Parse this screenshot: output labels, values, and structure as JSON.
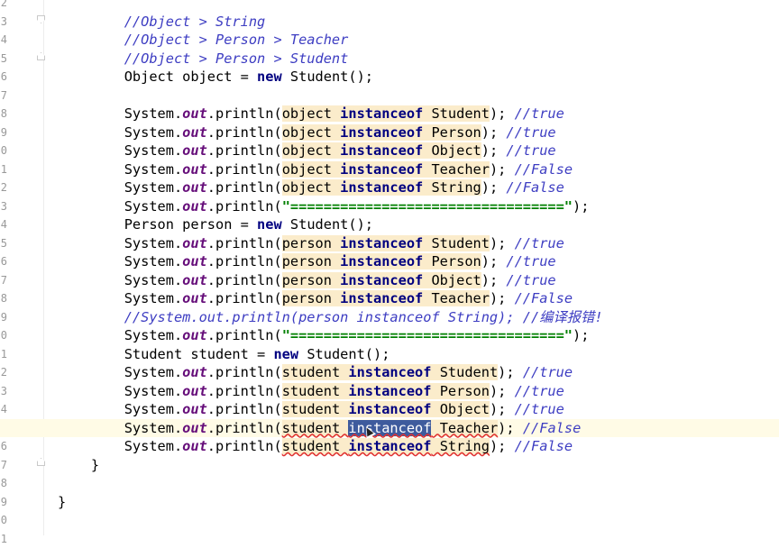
{
  "editor": {
    "line_numbers": [
      "2",
      "3",
      "4",
      "5",
      "6",
      "7",
      "8",
      "9",
      "0",
      "1",
      "2",
      "3",
      "4",
      "5",
      "6",
      "7",
      "8",
      "9",
      "0",
      "1",
      "2",
      "3",
      "4",
      "5",
      "6",
      "7",
      "8",
      "9",
      "0",
      "1"
    ],
    "colors": {
      "comment": "#3d3dc2",
      "keyword": "#000080",
      "static_field": "#660e7a",
      "string": "#008000",
      "match_highlight": "#fbeccb",
      "selection": "#3e5b9d",
      "current_line": "#fffbe6",
      "error_underline": "#e03030"
    },
    "lines": [
      {
        "indent": "",
        "segments": []
      },
      {
        "indent": "        ",
        "segments": [
          {
            "t": "cm",
            "s": "//Object > String"
          }
        ]
      },
      {
        "indent": "        ",
        "segments": [
          {
            "t": "cm",
            "s": "//Object > Person > Teacher"
          }
        ]
      },
      {
        "indent": "        ",
        "segments": [
          {
            "t": "cm",
            "s": "//Object > Person > Student"
          }
        ]
      },
      {
        "indent": "        ",
        "segments": [
          {
            "t": "",
            "s": "Object object = "
          },
          {
            "t": "kw",
            "s": "new"
          },
          {
            "t": "",
            "s": " Student();"
          }
        ]
      },
      {
        "indent": "",
        "segments": []
      },
      {
        "indent": "        ",
        "segments": [
          {
            "t": "",
            "s": "System."
          },
          {
            "t": "fld",
            "s": "out"
          },
          {
            "t": "",
            "s": ".println("
          },
          {
            "t": "hl",
            "s": "object "
          },
          {
            "t": "kw hl",
            "s": "instanceof"
          },
          {
            "t": "hl",
            "s": " Student"
          },
          {
            "t": "",
            "s": "); "
          },
          {
            "t": "cm",
            "s": "//true"
          }
        ]
      },
      {
        "indent": "        ",
        "segments": [
          {
            "t": "",
            "s": "System."
          },
          {
            "t": "fld",
            "s": "out"
          },
          {
            "t": "",
            "s": ".println("
          },
          {
            "t": "hl",
            "s": "object "
          },
          {
            "t": "kw hl",
            "s": "instanceof"
          },
          {
            "t": "hl",
            "s": " Person"
          },
          {
            "t": "",
            "s": "); "
          },
          {
            "t": "cm",
            "s": "//true"
          }
        ]
      },
      {
        "indent": "        ",
        "segments": [
          {
            "t": "",
            "s": "System."
          },
          {
            "t": "fld",
            "s": "out"
          },
          {
            "t": "",
            "s": ".println("
          },
          {
            "t": "hl",
            "s": "object "
          },
          {
            "t": "kw hl",
            "s": "instanceof"
          },
          {
            "t": "hl",
            "s": " Object"
          },
          {
            "t": "",
            "s": "); "
          },
          {
            "t": "cm",
            "s": "//true"
          }
        ]
      },
      {
        "indent": "        ",
        "segments": [
          {
            "t": "",
            "s": "System."
          },
          {
            "t": "fld",
            "s": "out"
          },
          {
            "t": "",
            "s": ".println("
          },
          {
            "t": "hl",
            "s": "object "
          },
          {
            "t": "kw hl",
            "s": "instanceof"
          },
          {
            "t": "hl",
            "s": " Teacher"
          },
          {
            "t": "",
            "s": "); "
          },
          {
            "t": "cm",
            "s": "//False"
          }
        ]
      },
      {
        "indent": "        ",
        "segments": [
          {
            "t": "",
            "s": "System."
          },
          {
            "t": "fld",
            "s": "out"
          },
          {
            "t": "",
            "s": ".println("
          },
          {
            "t": "hl",
            "s": "object "
          },
          {
            "t": "kw hl",
            "s": "instanceof"
          },
          {
            "t": "hl",
            "s": " String"
          },
          {
            "t": "",
            "s": "); "
          },
          {
            "t": "cm",
            "s": "//False"
          }
        ]
      },
      {
        "indent": "        ",
        "segments": [
          {
            "t": "",
            "s": "System."
          },
          {
            "t": "fld",
            "s": "out"
          },
          {
            "t": "",
            "s": ".println("
          },
          {
            "t": "str",
            "s": "\"=================================\""
          },
          {
            "t": "",
            "s": ");"
          }
        ]
      },
      {
        "indent": "        ",
        "segments": [
          {
            "t": "",
            "s": "Person person = "
          },
          {
            "t": "kw",
            "s": "new"
          },
          {
            "t": "",
            "s": " Student();"
          }
        ]
      },
      {
        "indent": "        ",
        "segments": [
          {
            "t": "",
            "s": "System."
          },
          {
            "t": "fld",
            "s": "out"
          },
          {
            "t": "",
            "s": ".println("
          },
          {
            "t": "hl",
            "s": "person "
          },
          {
            "t": "kw hl",
            "s": "instanceof"
          },
          {
            "t": "hl",
            "s": " Student"
          },
          {
            "t": "",
            "s": "); "
          },
          {
            "t": "cm",
            "s": "//true"
          }
        ]
      },
      {
        "indent": "        ",
        "segments": [
          {
            "t": "",
            "s": "System."
          },
          {
            "t": "fld",
            "s": "out"
          },
          {
            "t": "",
            "s": ".println("
          },
          {
            "t": "hl",
            "s": "person "
          },
          {
            "t": "kw hl",
            "s": "instanceof"
          },
          {
            "t": "hl",
            "s": " Person"
          },
          {
            "t": "",
            "s": "); "
          },
          {
            "t": "cm",
            "s": "//true"
          }
        ]
      },
      {
        "indent": "        ",
        "segments": [
          {
            "t": "",
            "s": "System."
          },
          {
            "t": "fld",
            "s": "out"
          },
          {
            "t": "",
            "s": ".println("
          },
          {
            "t": "hl",
            "s": "person "
          },
          {
            "t": "kw hl",
            "s": "instanceof"
          },
          {
            "t": "hl",
            "s": " Object"
          },
          {
            "t": "",
            "s": "); "
          },
          {
            "t": "cm",
            "s": "//true"
          }
        ]
      },
      {
        "indent": "        ",
        "segments": [
          {
            "t": "",
            "s": "System."
          },
          {
            "t": "fld",
            "s": "out"
          },
          {
            "t": "",
            "s": ".println("
          },
          {
            "t": "hl",
            "s": "person "
          },
          {
            "t": "kw hl",
            "s": "instanceof"
          },
          {
            "t": "hl",
            "s": " Teacher"
          },
          {
            "t": "",
            "s": "); "
          },
          {
            "t": "cm",
            "s": "//False"
          }
        ]
      },
      {
        "indent": "        ",
        "segments": [
          {
            "t": "cm",
            "s": "//System.out.println(person instanceof String); //编译报错!"
          }
        ]
      },
      {
        "indent": "        ",
        "segments": [
          {
            "t": "",
            "s": "System."
          },
          {
            "t": "fld",
            "s": "out"
          },
          {
            "t": "",
            "s": ".println("
          },
          {
            "t": "str",
            "s": "\"=================================\""
          },
          {
            "t": "",
            "s": ");"
          }
        ]
      },
      {
        "indent": "        ",
        "segments": [
          {
            "t": "",
            "s": "Student student = "
          },
          {
            "t": "kw",
            "s": "new"
          },
          {
            "t": "",
            "s": " Student();"
          }
        ]
      },
      {
        "indent": "        ",
        "segments": [
          {
            "t": "",
            "s": "System."
          },
          {
            "t": "fld",
            "s": "out"
          },
          {
            "t": "",
            "s": ".println("
          },
          {
            "t": "hl",
            "s": "student "
          },
          {
            "t": "kw hl",
            "s": "instanceof"
          },
          {
            "t": "hl",
            "s": " Student"
          },
          {
            "t": "",
            "s": "); "
          },
          {
            "t": "cm",
            "s": "//true"
          }
        ]
      },
      {
        "indent": "        ",
        "segments": [
          {
            "t": "",
            "s": "System."
          },
          {
            "t": "fld",
            "s": "out"
          },
          {
            "t": "",
            "s": ".println("
          },
          {
            "t": "hl",
            "s": "student "
          },
          {
            "t": "kw hl",
            "s": "instanceof"
          },
          {
            "t": "hl",
            "s": " Person"
          },
          {
            "t": "",
            "s": "); "
          },
          {
            "t": "cm",
            "s": "//true"
          }
        ]
      },
      {
        "indent": "        ",
        "segments": [
          {
            "t": "",
            "s": "System."
          },
          {
            "t": "fld",
            "s": "out"
          },
          {
            "t": "",
            "s": ".println("
          },
          {
            "t": "hl",
            "s": "student "
          },
          {
            "t": "kw hl",
            "s": "instanceof"
          },
          {
            "t": "hl",
            "s": " Object"
          },
          {
            "t": "",
            "s": "); "
          },
          {
            "t": "cm",
            "s": "//true"
          }
        ]
      },
      {
        "indent": "        ",
        "current": true,
        "segments": [
          {
            "t": "",
            "s": "System."
          },
          {
            "t": "fld",
            "s": "out"
          },
          {
            "t": "",
            "s": ".println("
          },
          {
            "t": "hl err",
            "s": "student "
          },
          {
            "t": "sel err",
            "s": "instanceof"
          },
          {
            "t": "hl err",
            "s": " Teacher"
          },
          {
            "t": "",
            "s": "); "
          },
          {
            "t": "cm",
            "s": "//False"
          }
        ]
      },
      {
        "indent": "        ",
        "segments": [
          {
            "t": "",
            "s": "System."
          },
          {
            "t": "fld",
            "s": "out"
          },
          {
            "t": "",
            "s": ".println("
          },
          {
            "t": "hl err",
            "s": "student "
          },
          {
            "t": "kw hl err",
            "s": "instanceof"
          },
          {
            "t": "hl err",
            "s": " String"
          },
          {
            "t": "",
            "s": "); "
          },
          {
            "t": "cm",
            "s": "//False"
          }
        ]
      },
      {
        "indent": "    ",
        "segments": [
          {
            "t": "",
            "s": "}"
          }
        ]
      },
      {
        "indent": "",
        "segments": []
      },
      {
        "indent": "",
        "segments": [
          {
            "t": "",
            "s": "}"
          }
        ]
      },
      {
        "indent": "",
        "segments": []
      },
      {
        "indent": "",
        "segments": []
      }
    ]
  }
}
